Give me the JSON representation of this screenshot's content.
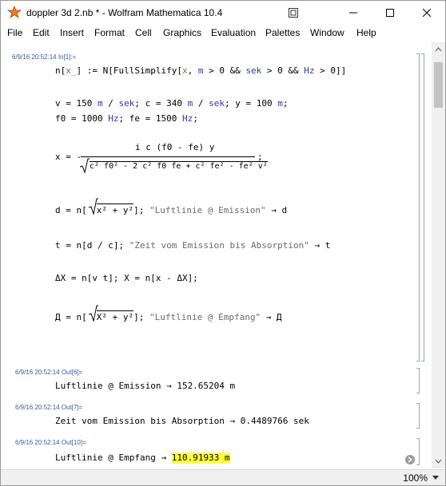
{
  "window": {
    "title": "doppler 3d 2.nb * - Wolfram Mathematica 10.4"
  },
  "menu": [
    "File",
    "Edit",
    "Insert",
    "Format",
    "Cell",
    "Graphics",
    "Evaluation",
    "Palettes",
    "Window",
    "Help"
  ],
  "input_cell": {
    "label": "6/9/16 20:52:14 In[1]:=",
    "line1": {
      "a": "n[",
      "b": "x_",
      "c": "] := N[FullSimplify[",
      "d": "x",
      "e": ", ",
      "f": "m",
      "g": " > 0 && ",
      "h": "sek",
      "i": " > 0 && ",
      "j": "Hz",
      "k": " > 0]]"
    },
    "line2": {
      "a": "v = 150 ",
      "b": "m",
      "c": " / ",
      "d": "sek",
      "e": "; c = 340 ",
      "f": "m",
      "g": " / ",
      "h": "sek",
      "i": "; y = 100 ",
      "j": "m",
      "k": ";"
    },
    "line3": {
      "a": "f0 = 1000 ",
      "b": "Hz",
      "c": "; fe = 1500 ",
      "d": "Hz",
      "e": ";"
    },
    "x_eq": {
      "lhs": "x = -",
      "num": "i c (f0 - fe) y",
      "den": "c² f0² - 2 c² f0 fe + c² fe² - fe² v²",
      "tail": ";"
    },
    "d_line": {
      "a": "d = n[",
      "b": "x² + y²",
      "c": "]; ",
      "d": "\"Luftlinie @ Emission\"",
      "e": " → d"
    },
    "t_line": {
      "a": "t = n[d / c]; ",
      "b": "\"Zeit vom Emission bis Absorption\"",
      "c": " → t"
    },
    "dx_line": "ΔX = n[v t]; X = n[x - ΔX];",
    "d2_line": {
      "a": "Д = n[",
      "b": "X² + y²",
      "c": "]; ",
      "d": "\"Luftlinie @ Empfang\"",
      "e": " → Д"
    }
  },
  "outputs": [
    {
      "label": "6/9/16 20:52:14 Out[6]=",
      "text": "Luftlinie @ Emission → 152.65204 m"
    },
    {
      "label": "6/9/16 20:52:14 Out[7]=",
      "text": "Zeit vom Emission bis Absorption → 0.4489766 sek"
    },
    {
      "label": "6/9/16 20:52:14 Out[10]=",
      "text_a": "Luftlinie @ Empfang → ",
      "text_b": "110.91933 m"
    }
  ],
  "status": {
    "zoom": "100%"
  },
  "colors": {
    "label": "#3c5a9a",
    "symbol": "#2c3aa8",
    "pattern": "#3f8f3f",
    "string": "#6a6a6a",
    "highlight": "#ffff3a"
  }
}
